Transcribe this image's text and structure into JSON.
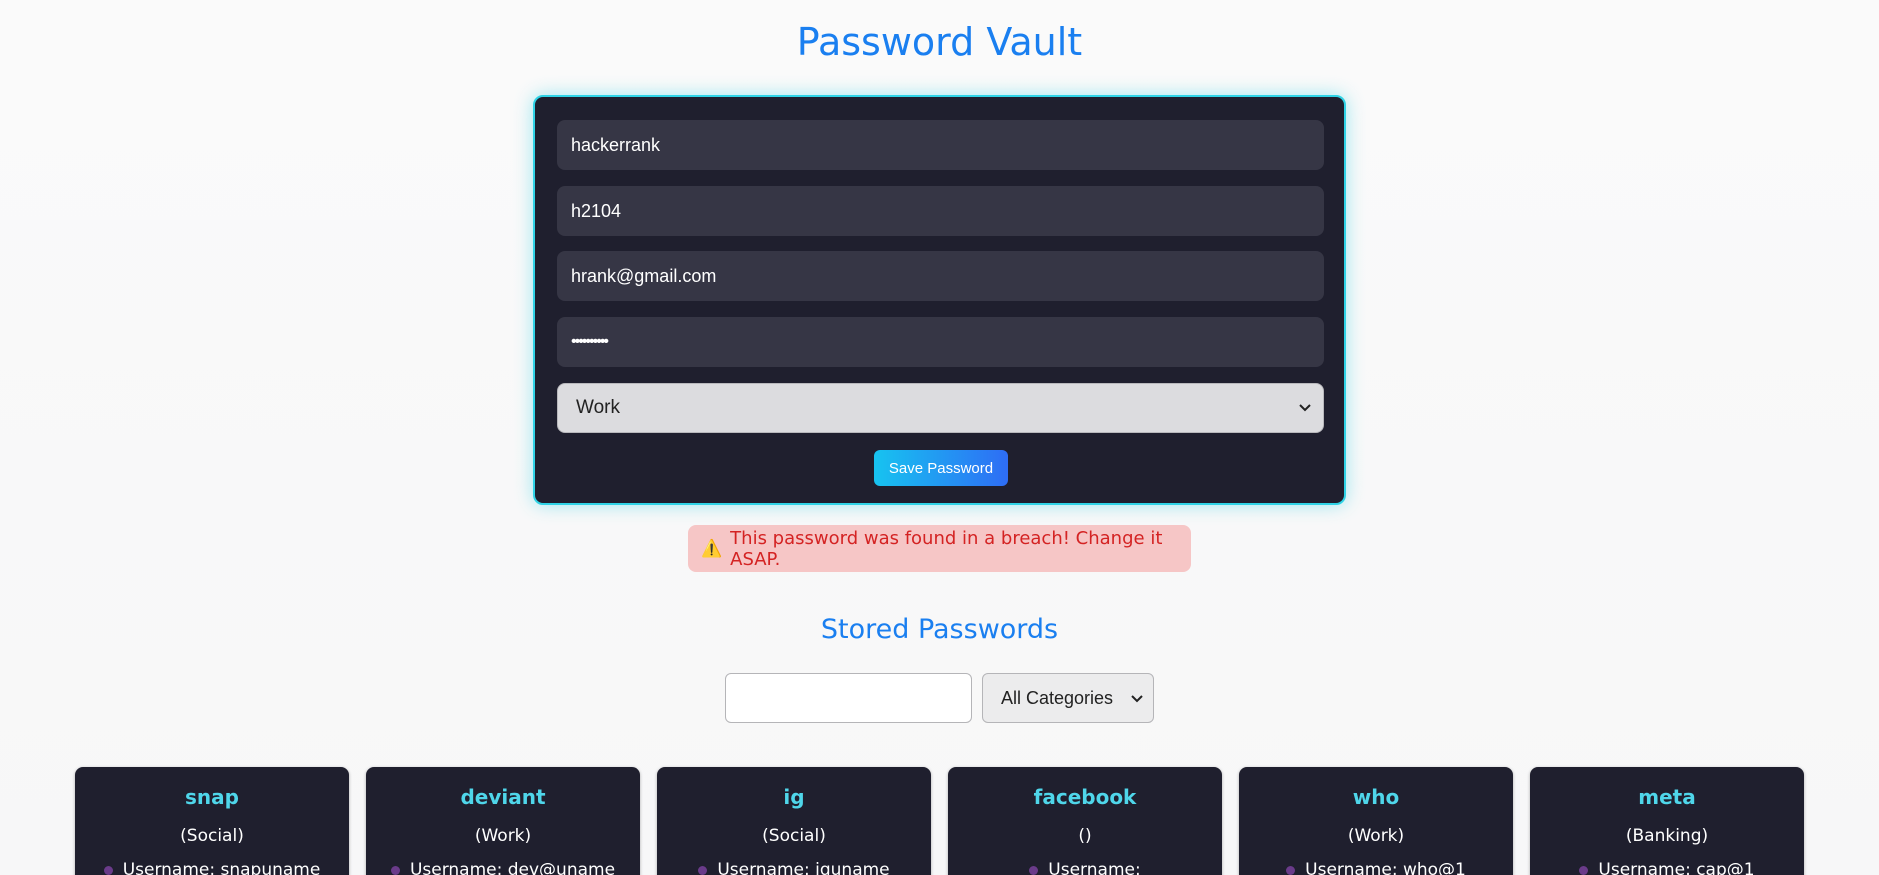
{
  "header": {
    "title": "Password Vault"
  },
  "form": {
    "site": "hackerrank",
    "username": "h2104",
    "email": "hrank@gmail.com",
    "password_masked": "••••••••••",
    "category": "Work",
    "save_label": "Save Password"
  },
  "alert": {
    "icon": "⚠️",
    "message": "This password was found in a breach! Change it ASAP."
  },
  "stored": {
    "title": "Stored Passwords",
    "search_value": "",
    "filter_selected": "All Categories"
  },
  "cards": [
    {
      "name": "snap",
      "category": "(Social)",
      "username": "Username: snapuname"
    },
    {
      "name": "deviant",
      "category": "(Work)",
      "username": "Username: dev@uname"
    },
    {
      "name": "ig",
      "category": "(Social)",
      "username": "Username: iguname"
    },
    {
      "name": "facebook",
      "category": "()",
      "username": "Username:"
    },
    {
      "name": "who",
      "category": "(Work)",
      "username": "Username: who@1"
    },
    {
      "name": "meta",
      "category": "(Banking)",
      "username": "Username: cap@1"
    }
  ],
  "colors": {
    "accent": "#1a7ff0",
    "card_bg": "#1f1f2e",
    "card_title": "#4fd6ea",
    "alert_bg": "#f6c6c6",
    "alert_text": "#d42323"
  }
}
